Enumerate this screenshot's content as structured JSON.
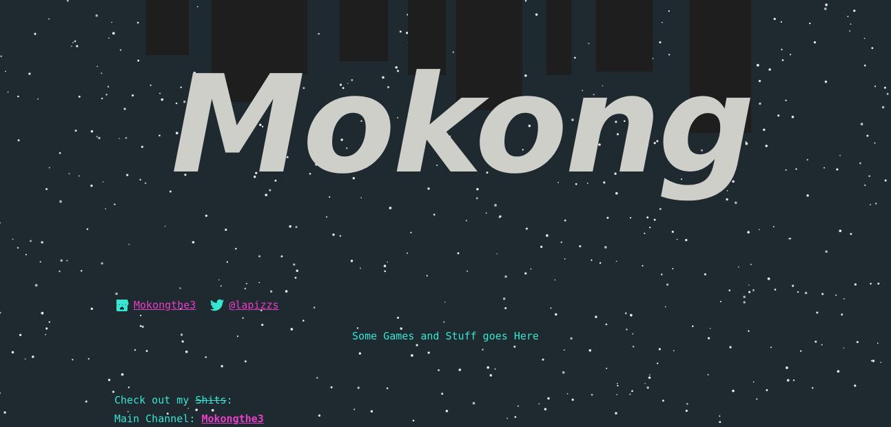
{
  "logo": {
    "text": "Mokong"
  },
  "social": {
    "itch_label": "Mokongthe3",
    "twitter_label": "@lapizzs"
  },
  "tagline": "Some Games and Stuff goes Here",
  "check_out": {
    "prefix": "Check out my ",
    "struck": "Shits",
    "suffix": ":"
  },
  "main_channel": {
    "label": "Main Channel: ",
    "link": "Mokongthe3"
  },
  "colors": {
    "background": "#1f2930",
    "bars": "#1e1e1f",
    "logo": "#cfcfca",
    "link": "#e93ec9",
    "text": "#35e6d3"
  }
}
